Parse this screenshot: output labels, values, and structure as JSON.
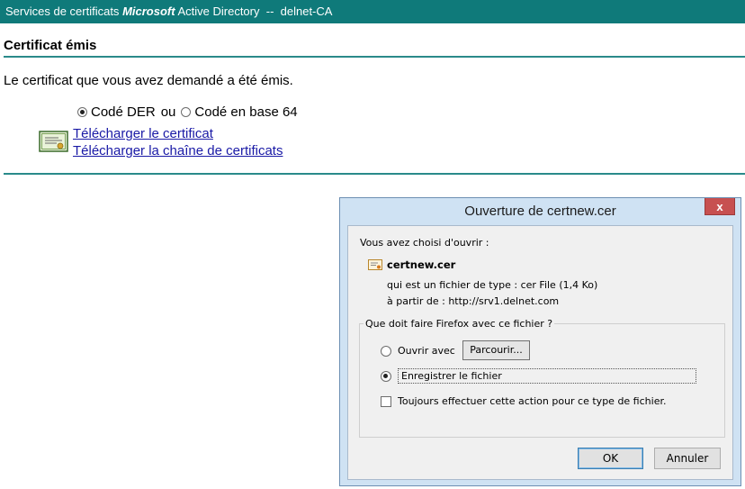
{
  "header": {
    "prefix": "Services de certificats",
    "brand": "Microsoft",
    "product": "Active Directory",
    "separator": "--",
    "ca_name": "delnet-CA"
  },
  "page": {
    "heading": "Certificat émis",
    "issued_message": "Le certificat que vous avez demandé a été émis."
  },
  "encoding": {
    "der_label": "Codé DER",
    "or_label": "ou",
    "base64_label": "Codé en base 64",
    "selected": "Codé DER"
  },
  "links": {
    "download_cert": "Télécharger le certificat",
    "download_chain": "Télécharger la chaîne de certificats"
  },
  "dialog": {
    "title": "Ouverture de certnew.cer",
    "close_glyph": "x",
    "chose_label": "Vous avez choisi d'ouvrir :",
    "filename": "certnew.cer",
    "type_label": "qui est un fichier de type :",
    "type_value": "cer File (1,4 Ko)",
    "source_label": "à partir de :",
    "source_value": "http://srv1.delnet.com",
    "question": "Que doit faire Firefox avec ce fichier ?",
    "open_with_label": "Ouvrir avec",
    "browse_label": "Parcourir...",
    "save_label": "Enregistrer le fichier",
    "always_label": "Toujours effectuer cette action pour ce type de fichier.",
    "selected_option": "Enregistrer le fichier",
    "always_checked": false,
    "ok_label": "OK",
    "cancel_label": "Annuler"
  }
}
